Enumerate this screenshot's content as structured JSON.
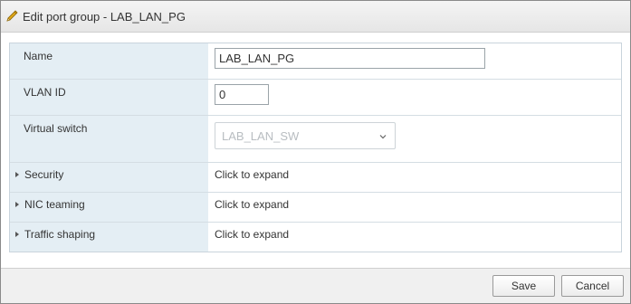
{
  "dialog": {
    "title": "Edit port group - LAB_LAN_PG"
  },
  "form": {
    "name": {
      "label": "Name",
      "value": "LAB_LAN_PG"
    },
    "vlan": {
      "label": "VLAN ID",
      "value": "0"
    },
    "vswitch": {
      "label": "Virtual switch",
      "selected": "LAB_LAN_SW"
    },
    "sections": [
      {
        "label": "Security",
        "value": "Click to expand"
      },
      {
        "label": "NIC teaming",
        "value": "Click to expand"
      },
      {
        "label": "Traffic shaping",
        "value": "Click to expand"
      }
    ]
  },
  "footer": {
    "save_label": "Save",
    "cancel_label": "Cancel"
  },
  "icons": {
    "title_icon": "pencil-icon",
    "dropdown_icon": "chevron-down-icon",
    "expand_icon": "caret-right-icon"
  },
  "colors": {
    "label_column_bg": "#e4eef4",
    "title_bar_bg": "#ececec",
    "icon_yellow": "#e0a818"
  }
}
